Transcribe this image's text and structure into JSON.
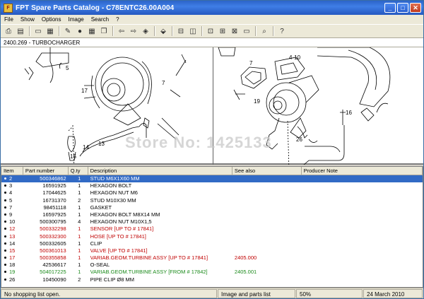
{
  "window": {
    "title": "FPT Spare Parts Catalog - C78ENTC26.00A004",
    "minimize": "_",
    "maximize": "□",
    "close": "✕"
  },
  "menu": [
    "File",
    "Show",
    "Options",
    "Image",
    "Search",
    "?"
  ],
  "path": "2400.269 - TURBOCHARGER",
  "watermark": "Store No: 1425133",
  "callouts": {
    "left": [
      "5",
      "17",
      "7",
      "14",
      "13",
      "15"
    ],
    "right": [
      "4-10",
      "7",
      "19",
      "26",
      "16"
    ]
  },
  "table": {
    "headers": [
      "Item",
      "Part number",
      "Q.ty",
      "Description",
      "See also",
      "Producer Note"
    ],
    "rows": [
      {
        "item": "2",
        "part": "500346862",
        "qty": "1",
        "desc": "STUD M6X1X60 MM",
        "see": "",
        "note": "",
        "color": "#000000",
        "selected": true
      },
      {
        "item": "3",
        "part": "16591925",
        "qty": "1",
        "desc": "HEXAGON BOLT",
        "see": "",
        "note": "",
        "color": "#000000"
      },
      {
        "item": "4",
        "part": "17044625",
        "qty": "1",
        "desc": "HEXAGON NUT M6",
        "see": "",
        "note": "",
        "color": "#000000"
      },
      {
        "item": "5",
        "part": "16731370",
        "qty": "2",
        "desc": "STUD M10X30 MM",
        "see": "",
        "note": "",
        "color": "#000000"
      },
      {
        "item": "7",
        "part": "98451118",
        "qty": "1",
        "desc": "GASKET",
        "see": "",
        "note": "",
        "color": "#000000"
      },
      {
        "item": "9",
        "part": "16597925",
        "qty": "1",
        "desc": "HEXAGON BOLT M8X14 MM",
        "see": "",
        "note": "",
        "color": "#000000"
      },
      {
        "item": "10",
        "part": "500300795",
        "qty": "4",
        "desc": "HEXAGON NUT M10X1,5",
        "see": "",
        "note": "",
        "color": "#000000"
      },
      {
        "item": "12",
        "part": "500332298",
        "qty": "1",
        "desc": "SENSOR  [UP TO # 17841]",
        "see": "",
        "note": "",
        "color": "#c00000"
      },
      {
        "item": "13",
        "part": "500332300",
        "qty": "1",
        "desc": "HOSE  [UP TO # 17841]",
        "see": "",
        "note": "",
        "color": "#c00000"
      },
      {
        "item": "14",
        "part": "500332605",
        "qty": "1",
        "desc": "CLIP",
        "see": "",
        "note": "",
        "color": "#000000"
      },
      {
        "item": "15",
        "part": "500361013",
        "qty": "1",
        "desc": "VALVE  [UP TO # 17841]",
        "see": "",
        "note": "",
        "color": "#c00000"
      },
      {
        "item": "17",
        "part": "500355858",
        "qty": "1",
        "desc": "VARIAB.GEOM.TURBINE ASSY [UP TO # 17841]",
        "see": "2405.000",
        "note": "",
        "color": "#c00000"
      },
      {
        "item": "18",
        "part": "42536617",
        "qty": "1",
        "desc": "O-SEAL",
        "see": "",
        "note": "",
        "color": "#000000"
      },
      {
        "item": "19",
        "part": "504017225",
        "qty": "1",
        "desc": "VARIAB.GEOM.TURBINE ASSY [FROM # 17842]",
        "see": "2405.001",
        "note": "",
        "color": "#1a8a1a"
      },
      {
        "item": "26",
        "part": "10450090",
        "qty": "2",
        "desc": "PIPE CLIP Ø8 MM",
        "see": "",
        "note": "",
        "color": "#000000"
      }
    ]
  },
  "status": {
    "shopping": "No shopping list open.",
    "view": "Image and parts list",
    "zoom": "50%",
    "date": "24 March 2010"
  },
  "colors": {
    "titlebar": "#2c64c8",
    "selection": "#316ac5",
    "red_text": "#c00000",
    "green_text": "#1a8a1a"
  }
}
